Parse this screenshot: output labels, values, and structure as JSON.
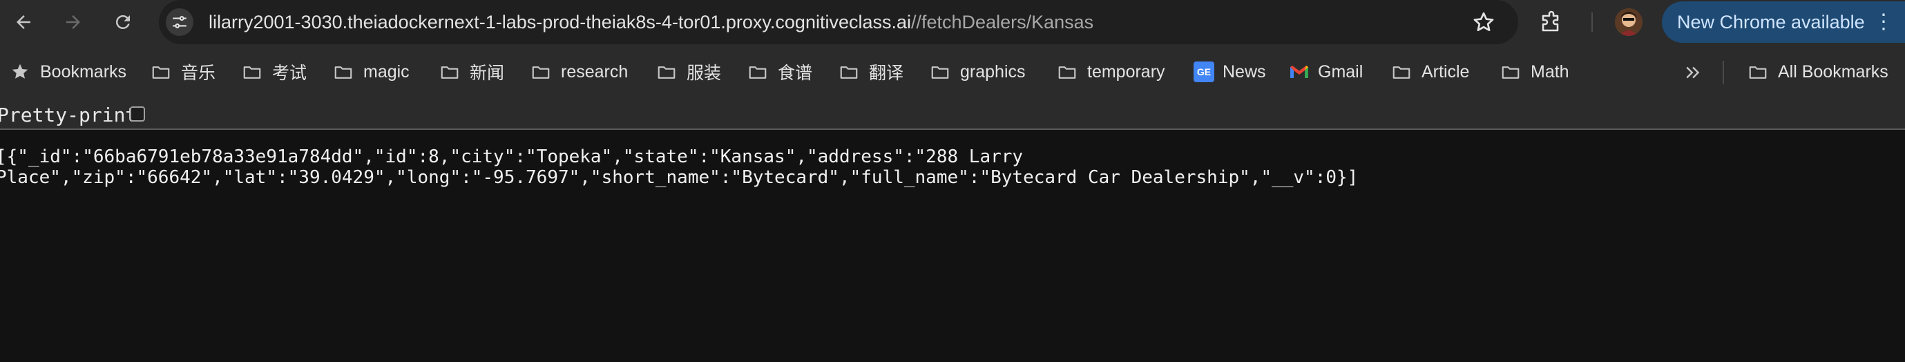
{
  "toolbar": {
    "url_host": "lilarry2001-3030.theiadockernext-1-labs-prod-theiak8s-4-tor01.proxy.cognitiveclass.ai",
    "url_path": "//fetchDealers/Kansas",
    "update_label": "New Chrome available"
  },
  "bookmarks": {
    "items": [
      {
        "label": "Bookmarks",
        "icon": "star-icon"
      },
      {
        "label": "音乐",
        "icon": "folder-icon"
      },
      {
        "label": "考试",
        "icon": "folder-icon"
      },
      {
        "label": "magic",
        "icon": "folder-icon"
      },
      {
        "label": "新闻",
        "icon": "folder-icon"
      },
      {
        "label": "research",
        "icon": "folder-icon"
      },
      {
        "label": "服装",
        "icon": "folder-icon"
      },
      {
        "label": "食谱",
        "icon": "folder-icon"
      },
      {
        "label": "翻译",
        "icon": "folder-icon"
      },
      {
        "label": "graphics",
        "icon": "folder-icon"
      },
      {
        "label": "temporary",
        "icon": "folder-icon"
      },
      {
        "label": "News",
        "icon": "google-news-icon"
      },
      {
        "label": "Gmail",
        "icon": "gmail-icon"
      },
      {
        "label": "Article",
        "icon": "folder-icon"
      },
      {
        "label": "Math",
        "icon": "folder-icon"
      }
    ],
    "all_label": "All Bookmarks"
  },
  "viewer": {
    "pretty_print_label": "Pretty-print",
    "json_line1": "[{\"_id\":\"66ba6791eb78a33e91a784dd\",\"id\":8,\"city\":\"Topeka\",\"state\":\"Kansas\",\"address\":\"288 Larry",
    "json_line2": "Place\",\"zip\":\"66642\",\"lat\":\"39.0429\",\"long\":\"-95.7697\",\"short_name\":\"Bytecard\",\"full_name\":\"Bytecard Car Dealership\",\"__v\":0}]"
  },
  "colors": {
    "toolbar_bg": "#2b2b2b",
    "omnibox_bg": "#1f1f1f",
    "page_bg": "#121212",
    "update_bg": "#1e4a73"
  }
}
